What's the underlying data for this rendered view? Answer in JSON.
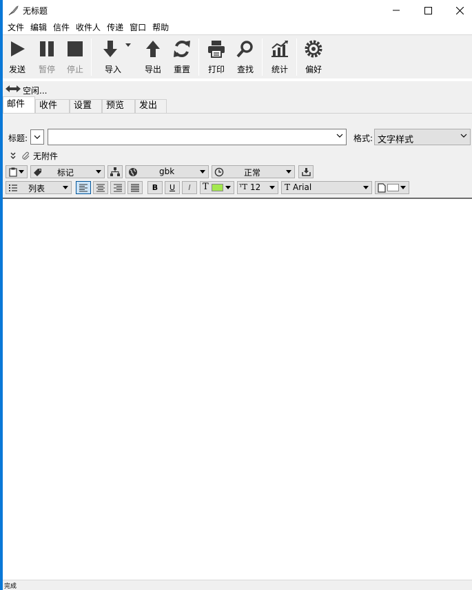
{
  "window": {
    "title": "无标题"
  },
  "menu": [
    "文件",
    "编辑",
    "信件",
    "收件人",
    "传递",
    "窗口",
    "帮助"
  ],
  "toolbar": {
    "send": "发送",
    "pause": "暂停",
    "stop": "停止",
    "import": "导入",
    "export": "导出",
    "reset": "重置",
    "print": "打印",
    "find": "查找",
    "stats": "统计",
    "prefs": "偏好"
  },
  "status": "空闲...",
  "tabs": [
    "邮件",
    "收件人",
    "设置",
    "预览",
    "发出"
  ],
  "compose": {
    "subject_label": "标题:",
    "subject_value": "",
    "format_label": "格式:",
    "format_value": "文字样式",
    "attachments": "无附件"
  },
  "format_bar": {
    "mark": "标记",
    "charset": "gbk",
    "priority": "正常",
    "list": "列表",
    "bold": "B",
    "underline": "U",
    "italic": "I",
    "font_size": "12",
    "font_name": "Arial",
    "text_color": "#a4e84e",
    "bg_color": "#ffffff"
  },
  "footer": "完成"
}
